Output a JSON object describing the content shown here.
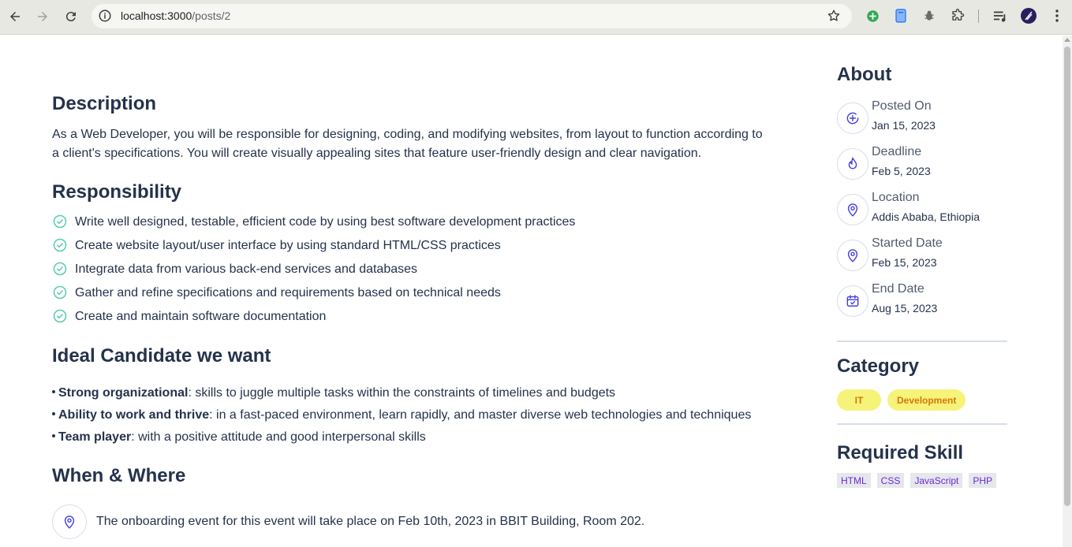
{
  "browser": {
    "url_host": "localhost:3000",
    "url_path": "/posts/2"
  },
  "main": {
    "description": {
      "title": "Description",
      "text": "As a Web Developer, you will be responsible for designing, coding, and modifying websites, from layout to function according to a client's specifications. You will create visually appealing sites that feature user-friendly design and clear navigation."
    },
    "responsibility": {
      "title": "Responsibility",
      "items": [
        "Write well designed, testable, efficient code by using best software development practices",
        "Create website layout/user interface by using standard HTML/CSS practices",
        "Integrate data from various back-end services and databases",
        "Gather and refine specifications and requirements based on technical needs",
        "Create and maintain software documentation"
      ]
    },
    "ideal": {
      "title": "Ideal Candidate we want",
      "items": [
        {
          "bold": "Strong organizational",
          "text": ": skills to juggle multiple tasks within the constraints of timelines and budgets"
        },
        {
          "bold": "Ability to work and thrive",
          "text": ": in a fast-paced environment, learn rapidly, and master diverse web technologies and techniques"
        },
        {
          "bold": "Team player",
          "text": ": with a positive attitude and good interpersonal skills"
        }
      ]
    },
    "when_where": {
      "title": "When & Where",
      "text": "The onboarding event for this event will take place on Feb 10th, 2023 in BBIT Building, Room 202."
    }
  },
  "sidebar": {
    "about_title": "About",
    "meta": [
      {
        "label": "Posted On",
        "value": "Jan 15, 2023",
        "icon": "plus-circle-icon"
      },
      {
        "label": "Deadline",
        "value": "Feb 5, 2023",
        "icon": "fire-icon"
      },
      {
        "label": "Location",
        "value": "Addis Ababa, Ethiopia",
        "icon": "location-pin-icon"
      },
      {
        "label": "Started Date",
        "value": "Feb 15, 2023",
        "icon": "location-pin-icon"
      },
      {
        "label": "End Date",
        "value": "Aug 15, 2023",
        "icon": "calendar-check-icon"
      }
    ],
    "category_title": "Category",
    "categories": [
      "IT",
      "Development"
    ],
    "skills_title": "Required Skill",
    "skills": [
      "HTML",
      "CSS",
      "JavaScript",
      "PHP"
    ]
  },
  "colors": {
    "accent_green": "#56cdad",
    "icon_blue": "#4640de",
    "category_bg": "#f6f37a",
    "category_text": "#d97706",
    "skill_text": "#6d28d9"
  }
}
